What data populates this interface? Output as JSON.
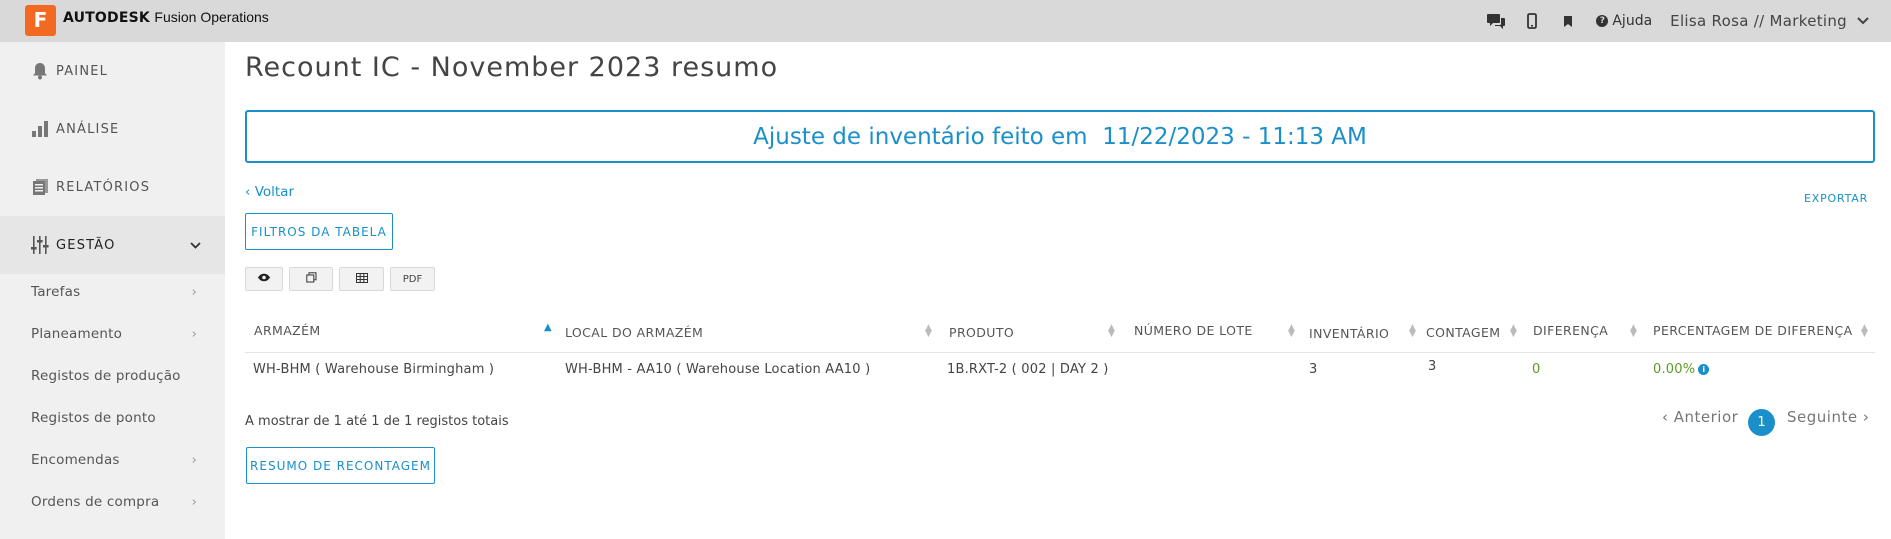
{
  "topbar": {
    "logo_letter": "F",
    "brand_bold": "AUTODESK",
    "brand_rest": "Fusion Operations",
    "icons": [
      "chat-icon",
      "mobile-icon",
      "bookmark-icon"
    ],
    "help_label": "Ajuda",
    "user": "Elisa Rosa // Marketing"
  },
  "sidebar": {
    "main": [
      {
        "label": "PAINEL",
        "icon": "bell-icon"
      },
      {
        "label": "ANÁLISE",
        "icon": "bar-chart-icon"
      },
      {
        "label": "RELATÓRIOS",
        "icon": "reports-icon"
      },
      {
        "label": "GESTÃO",
        "icon": "sliders-icon"
      }
    ],
    "sub": [
      {
        "label": "Tarefas",
        "has_arrow": true
      },
      {
        "label": "Planeamento",
        "has_arrow": true
      },
      {
        "label": "Registos de produção",
        "has_arrow": false
      },
      {
        "label": "Registos de ponto",
        "has_arrow": false
      },
      {
        "label": "Encomendas",
        "has_arrow": true
      },
      {
        "label": "Ordens de compra",
        "has_arrow": true
      }
    ]
  },
  "main": {
    "title": "Recount IC - November 2023 resumo",
    "banner": "Ajuste de inventário feito em  11/22/2023 - 11:13 AM",
    "back_link": "‹ Voltar",
    "export": "EXPORTAR",
    "filters_button": "FILTROS DA TABELA",
    "toolbar": {
      "pdf": "PDF"
    },
    "table": {
      "headers": [
        "ARMAZÉM",
        "LOCAL DO ARMAZÉM",
        "PRODUTO",
        "NÚMERO DE LOTE",
        "INVENTÁRIO",
        "CONTAGEM",
        "DIFERENÇA",
        "PERCENTAGEM DE DIFERENÇA"
      ],
      "rows": [
        [
          "WH-BHM ( Warehouse Birmingham )",
          "WH-BHM - AA10 ( Warehouse Location AA10 )",
          "1B.RXT-2 ( 002 | DAY 2 )",
          "",
          "3",
          "3",
          "0",
          "0.00%"
        ]
      ]
    },
    "showing": "A mostrar de 1 até 1 de 1 registos totais",
    "pagination": {
      "prev": "‹ Anterior",
      "current": "1",
      "next": "Seguinte ›"
    },
    "recount_button": "RESUMO DE RECONTAGEM"
  },
  "colors": {
    "accent": "#1a8fc9",
    "positive": "#5a9a2a",
    "brand": "#f26a21"
  }
}
